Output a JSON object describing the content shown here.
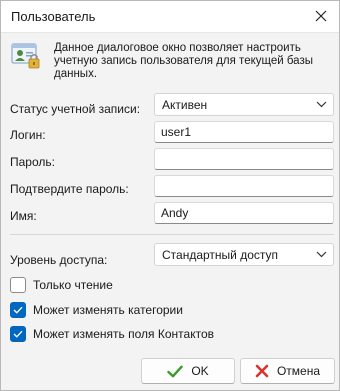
{
  "window": {
    "title": "Пользователь"
  },
  "info": {
    "icon": "user-card-icon",
    "text": "Данное диалоговое окно позволяет настроить учетную запись пользователя для текущей базы данных."
  },
  "form": {
    "status_label": "Статус учетной записи:",
    "status_value": "Активен",
    "login_label": "Логин:",
    "login_value": "user1",
    "password_label": "Пароль:",
    "password_value": "",
    "confirm_label": "Подтвердите пароль:",
    "confirm_value": "",
    "name_label": "Имя:",
    "name_value": "Andy",
    "access_label": "Уровень доступа:",
    "access_value": "Стандартный доступ"
  },
  "options": {
    "readonly_label": "Только чтение",
    "readonly_checked": false,
    "categories_label": "Может изменять категории",
    "categories_checked": true,
    "contacts_label": "Может изменять поля Контактов",
    "contacts_checked": true
  },
  "buttons": {
    "ok_label": "OK",
    "cancel_label": "Отмена"
  },
  "colors": {
    "accent": "#0067c0",
    "ok_check": "#3a9a2a",
    "cancel_x": "#d9342b"
  }
}
